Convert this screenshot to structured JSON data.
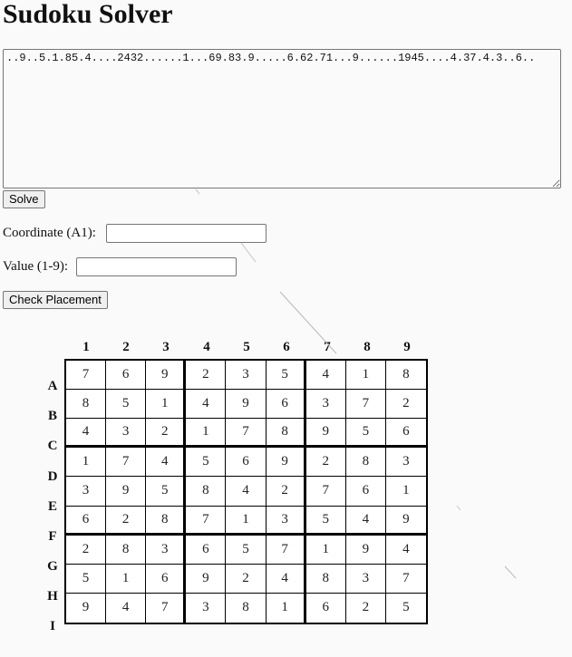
{
  "title": "Sudoku Solver",
  "puzzle_input": {
    "value": "..9..5.1.85.4....2432......1...69.83.9.....6.62.71...9......1945....4.37.4.3..6.."
  },
  "solve_button": {
    "label": "Solve"
  },
  "coordinate": {
    "label": "Coordinate (A1):",
    "value": ""
  },
  "value_field": {
    "label": "Value (1-9):",
    "value": ""
  },
  "check_button": {
    "label": "Check Placement"
  },
  "board": {
    "column_labels": [
      "1",
      "2",
      "3",
      "4",
      "5",
      "6",
      "7",
      "8",
      "9"
    ],
    "row_labels": [
      "A",
      "B",
      "C",
      "D",
      "E",
      "F",
      "G",
      "H",
      "I"
    ],
    "cells": [
      [
        "7",
        "6",
        "9",
        "2",
        "3",
        "5",
        "4",
        "1",
        "8"
      ],
      [
        "8",
        "5",
        "1",
        "4",
        "9",
        "6",
        "3",
        "7",
        "2"
      ],
      [
        "4",
        "3",
        "2",
        "1",
        "7",
        "8",
        "9",
        "5",
        "6"
      ],
      [
        "1",
        "7",
        "4",
        "5",
        "6",
        "9",
        "2",
        "8",
        "3"
      ],
      [
        "3",
        "9",
        "5",
        "8",
        "4",
        "2",
        "7",
        "6",
        "1"
      ],
      [
        "6",
        "2",
        "8",
        "7",
        "1",
        "3",
        "5",
        "4",
        "9"
      ],
      [
        "2",
        "8",
        "3",
        "6",
        "5",
        "7",
        "1",
        "9",
        "4"
      ],
      [
        "5",
        "1",
        "6",
        "9",
        "2",
        "4",
        "8",
        "3",
        "7"
      ],
      [
        "9",
        "4",
        "7",
        "3",
        "8",
        "1",
        "6",
        "2",
        "5"
      ]
    ]
  }
}
